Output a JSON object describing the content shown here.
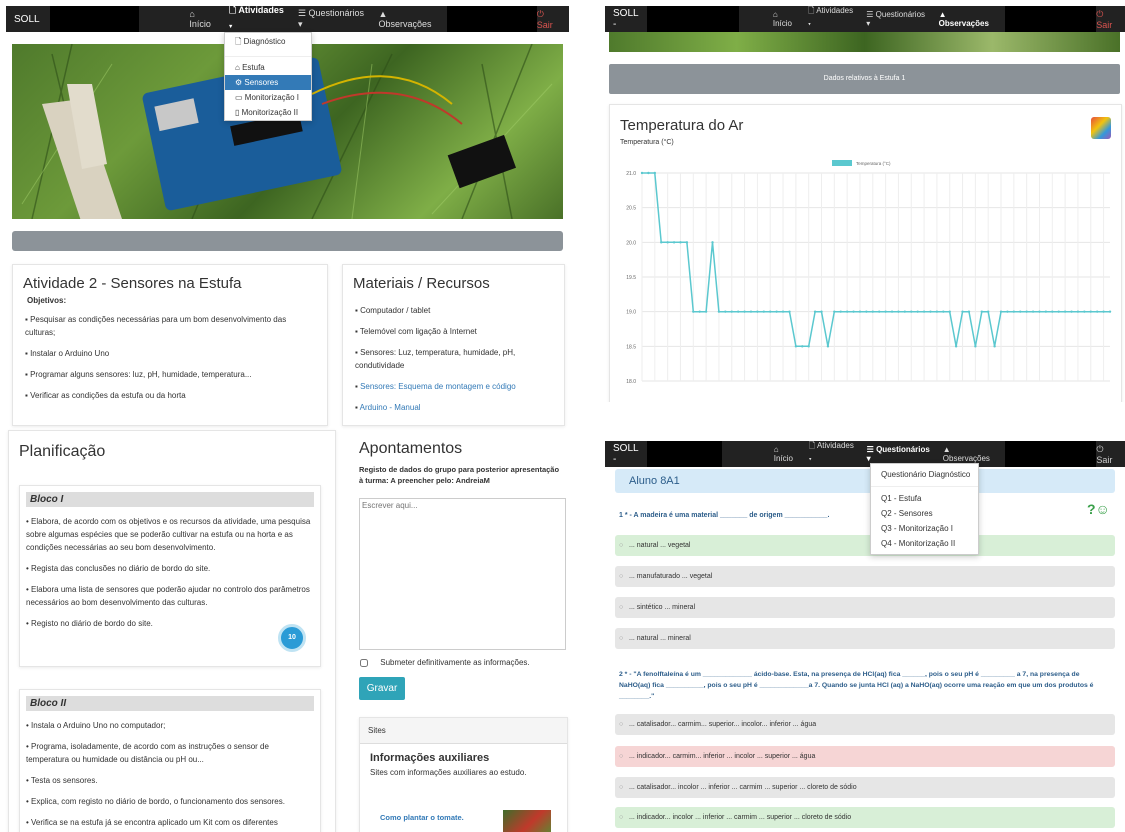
{
  "nav": {
    "brand": "SOLL",
    "brand_dash": "SOLL -",
    "inicio": "Início",
    "atividades": "Atividades",
    "questionarios": "Questionários",
    "observacoes": "Observações",
    "sair": "Sair"
  },
  "atividades_menu": {
    "items": [
      "Diagnóstico",
      "Estufa",
      "Sensores",
      "Monitorização I",
      "Monitorização II"
    ],
    "selected": "Sensores"
  },
  "atividade": {
    "title": "Atividade 2 - Sensores na Estufa",
    "objetivos_label": "Objetivos:",
    "items": [
      "Pesquisar as condições necessárias para um bom desenvolvimento das culturas;",
      "Instalar o Arduino Uno",
      "Programar alguns sensores: luz, pH, humidade, temperatura...",
      "Verificar as condições da estufa ou da horta"
    ]
  },
  "materiais": {
    "title": "Materiais / Recursos",
    "items": [
      "Computador / tablet",
      "Telemóvel com ligação à Internet",
      "Sensores: Luz, temperatura, humidade, pH, condutividade"
    ],
    "links": [
      "Sensores: Esquema de montagem e código",
      "Arduino - Manual"
    ]
  },
  "planificacao": {
    "title": "Planificação",
    "bloco1": {
      "title": "Bloco I",
      "items": [
        "Elabora, de acordo com os objetivos e os recursos da atividade, uma pesquisa sobre algumas espécies que se poderão cultivar na estufa ou na horta e as condições necessárias ao seu bom desenvolvimento.",
        "Regista das conclusões no diário de bordo do site.",
        "Elabora uma lista de sensores que poderão ajudar no controlo dos parâmetros necessários ao bom desenvolvimento das culturas.",
        "Registo no diário de bordo do site."
      ],
      "badge": "10"
    },
    "bloco2": {
      "title": "Bloco II",
      "items": [
        "Instala o Arduino Uno no computador;",
        "Programa, isoladamente, de acordo com as instruções o sensor de temperatura ou humidade ou distância ou pH ou...",
        "Testa os sensores.",
        "Explica, com registo no diário de bordo, o funcionamento dos sensores.",
        "Verifica se na estufa já se encontra aplicado um Kit com os diferentes"
      ]
    }
  },
  "apontamentos": {
    "title": "Apontamentos",
    "subtitle": "Registo de dados do grupo para posterior apresentação à turma: A preencher pelo: AndreiaM",
    "placeholder": "Escrever aqui...",
    "checkbox_label": "Submeter definitivamente as informações.",
    "button": "Gravar",
    "sites_header": "Sites",
    "info_title": "Informações auxiliares",
    "info_desc": "Sites com informações auxiliares ao estudo.",
    "tomate_link": "Como plantar o tomate."
  },
  "estufa": {
    "banner": "Dados relativos à Estufa 1",
    "chart_title": "Temperatura do Ar",
    "chart_subtitle": "Temperatura (°C)"
  },
  "chart_data": {
    "type": "line",
    "series": [
      {
        "name": "Temperatura (°C)",
        "values": [
          21,
          21,
          21,
          20,
          20,
          20,
          20,
          20,
          19,
          19,
          19,
          20,
          19,
          19,
          19,
          19,
          19,
          19,
          19,
          19,
          19,
          19,
          19,
          19,
          18.5,
          18.5,
          18.5,
          19,
          19,
          18.5,
          19,
          19,
          19,
          19,
          19,
          19,
          19,
          19,
          19,
          19,
          19,
          19,
          19,
          19,
          19,
          19,
          19,
          19,
          19,
          18.5,
          19,
          19,
          18.5,
          19,
          19,
          18.5,
          19,
          19,
          19,
          19,
          19,
          19,
          19,
          19,
          19,
          19,
          19,
          19,
          19,
          19,
          19,
          19,
          19,
          19
        ]
      }
    ],
    "y_ticks": [
      "21.0",
      "20.5",
      "20.0",
      "19.5",
      "19.0",
      "18.5",
      "18.0"
    ],
    "ylim": [
      18,
      21
    ],
    "grid": true,
    "legend": "top"
  },
  "questionarios_menu": {
    "items": [
      "Questionário Diagnóstico",
      "Q1 - Estufa",
      "Q2 - Sensores",
      "Q3 - Monitorização I",
      "Q4 - Monitorização II"
    ]
  },
  "quiz": {
    "aluno": "Aluno 8A1",
    "q1": "1 * - A madeira é uma material _______ de origem ___________.",
    "q1_answers": [
      "... natural ... vegetal",
      "... manufaturado ... vegetal",
      "... sintético ... mineral",
      "... natural ... mineral"
    ],
    "q2": "2 * - \"A fenolftaleína é um _____________ ácido-base. Esta, na presença de HCl(aq) fica ______, pois o seu pH é _________ a 7, na presença de NaHO(aq) fica __________, pois o seu pH é _____________a 7. Quando se junta HCl (aq) a NaHO(aq) ocorre uma reação em que um dos produtos é ________.\"",
    "q2_answers": [
      "... catalisador... carmim... superior... incolor... inferior ... água",
      "... indicador... carmim... inferior ... incolor ... superior ... água",
      "... catalisador... incolor ... inferior ... carmim ... superior ... cloreto de sódio",
      "... indicador... incolor ... inferior ... carmim ... superior ... cloreto de sódio"
    ]
  }
}
